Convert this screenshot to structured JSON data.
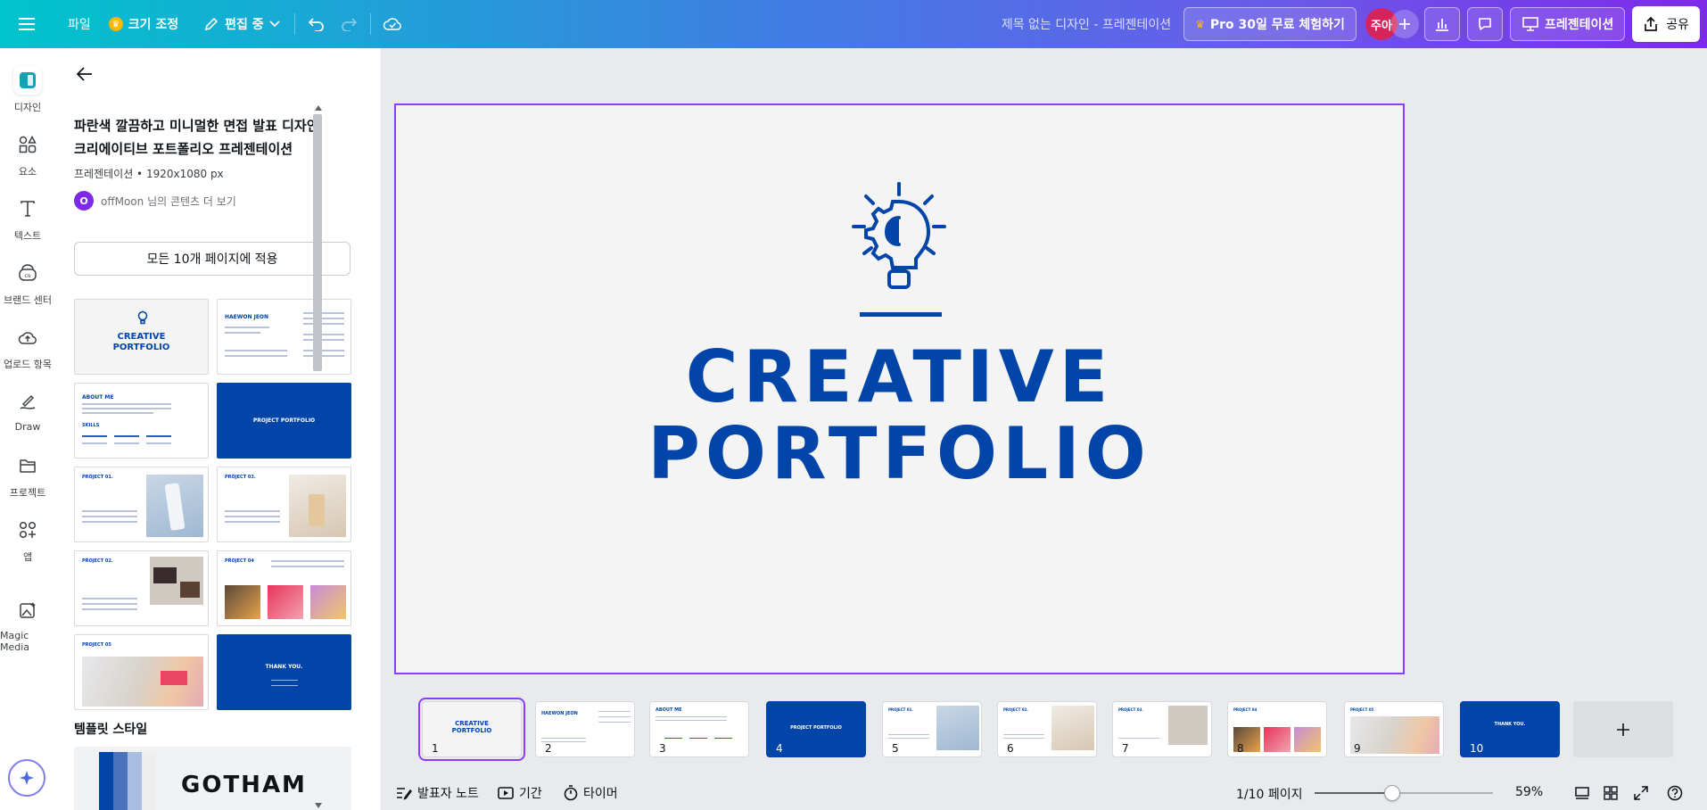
{
  "topbar": {
    "file": "파일",
    "resize": "크기 조정",
    "editing": "편집 중",
    "doc_title": "제목 없는 디자인 - 프레젠테이션",
    "pro_trial": "Pro 30일 무료 체험하기",
    "avatar_initials": "주아",
    "present": "프레젠테이션",
    "share": "공유"
  },
  "rail": {
    "items": [
      {
        "label": "디자인",
        "icon": "design-icon"
      },
      {
        "label": "요소",
        "icon": "elements-icon"
      },
      {
        "label": "텍스트",
        "icon": "text-icon"
      },
      {
        "label": "브랜드 센터",
        "icon": "brand-icon"
      },
      {
        "label": "업로드 항목",
        "icon": "upload-icon"
      },
      {
        "label": "Draw",
        "icon": "draw-icon"
      },
      {
        "label": "프로젝트",
        "icon": "folder-icon"
      },
      {
        "label": "앱",
        "icon": "apps-icon"
      },
      {
        "label": "Magic Media",
        "icon": "magic-media-icon"
      }
    ]
  },
  "panel": {
    "title_line1": "파란색 깔끔하고 미니멀한 면접 발표 디자인",
    "title_line2": "크리에이티브 포트폴리오 프레젠테이션",
    "meta": "프레젠테이션 • 1920x1080 px",
    "author_initial": "O",
    "author_text": "offMoon 님의 콘텐츠 더 보기",
    "apply_all": "모든 10개 페이지에 적용",
    "thumbs": [
      {
        "t": "CREATIVE\nPORTFOLIO"
      },
      {
        "t": "HAEWON JEON"
      },
      {
        "t": "ABOUT ME"
      },
      {
        "t": "PROJECT PORTFOLIO"
      },
      {
        "t": "PROJECT 01."
      },
      {
        "t": "PROJECT 02."
      },
      {
        "t": "PROJECT 03."
      },
      {
        "t": "PROJECT 04"
      },
      {
        "t": "PROJECT 05"
      },
      {
        "t": "THANK YOU."
      }
    ],
    "skills_label": "SKILLS",
    "style_section": "템플릿 스타일",
    "font_sample": "GOTHAM"
  },
  "slide": {
    "line1": "CREATIVE",
    "line2": "PORTFOLIO"
  },
  "film": {
    "pages": [
      "1",
      "2",
      "3",
      "4",
      "5",
      "6",
      "7",
      "8",
      "9",
      "10"
    ],
    "thumb_labels": [
      "CREATIVE PORTFOLIO",
      "HAEWON JEON",
      "ABOUT ME",
      "PROJECT PORTFOLIO",
      "PROJECT 01.",
      "PROJECT 02.",
      "PROJECT 03.",
      "PROJECT 04",
      "PROJECT 05",
      "THANK YOU."
    ]
  },
  "bottom": {
    "notes": "발표자 노트",
    "duration": "기간",
    "timer": "타이머",
    "page_indicator": "1/10 페이지",
    "zoom": "59%",
    "zoom_level": 0.59
  },
  "colors": {
    "brand_blue": "#0245a8",
    "accent_purple": "#8b3dff",
    "avatar": "#d5245d"
  }
}
